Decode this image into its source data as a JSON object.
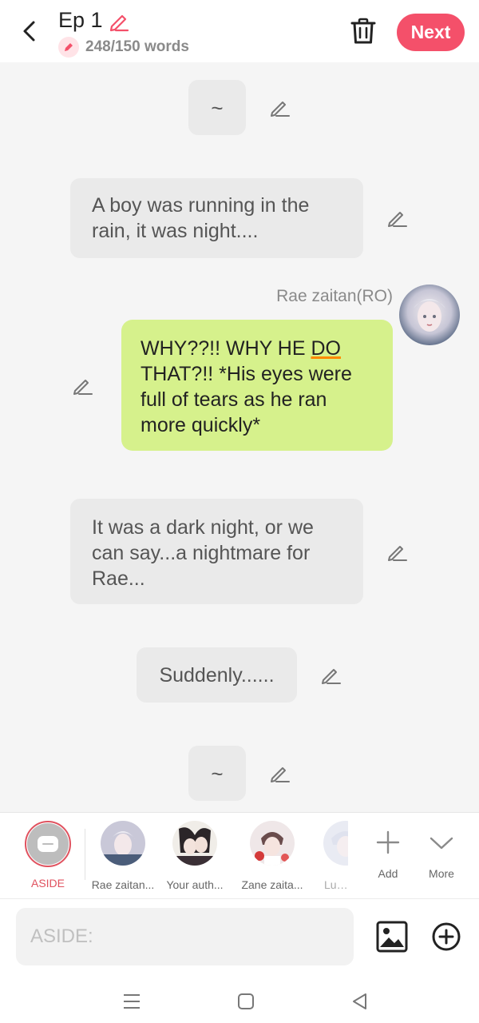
{
  "header": {
    "episode_title": "Ep 1",
    "word_count": "248/150 words",
    "next_label": "Next"
  },
  "story": {
    "aside_1": "~",
    "narration_1_line1": "A boy was running in the",
    "narration_1_line2a": "rain",
    "narration_1_line2b": " it was night....",
    "speaker_name": "Rae zaitan(RO)",
    "dialogue_part1": "WHY??!! WHY HE ",
    "dialogue_underlined": "DO",
    "dialogue_part2": " THAT?!! *His eyes were full of tears as he ran more quickly*",
    "narration_2": "It was a dark night, or we can say...a nightmare for Rae...",
    "narration_3": "Suddenly......",
    "aside_2": "~"
  },
  "characters": [
    {
      "label": "ASIDE",
      "selected": true
    },
    {
      "label": "Rae zaitan..."
    },
    {
      "label": "Your auth..."
    },
    {
      "label": "Zane zaita..."
    },
    {
      "label": "Luca"
    }
  ],
  "actions": {
    "add_label": "Add",
    "more_label": "More"
  },
  "composer": {
    "placeholder": "ASIDE:"
  },
  "colors": {
    "accent": "#f4506a",
    "dialogue_bubble": "#d6f18c",
    "narration_bubble": "#eaeaea",
    "aside_selected": "#e0525f"
  }
}
